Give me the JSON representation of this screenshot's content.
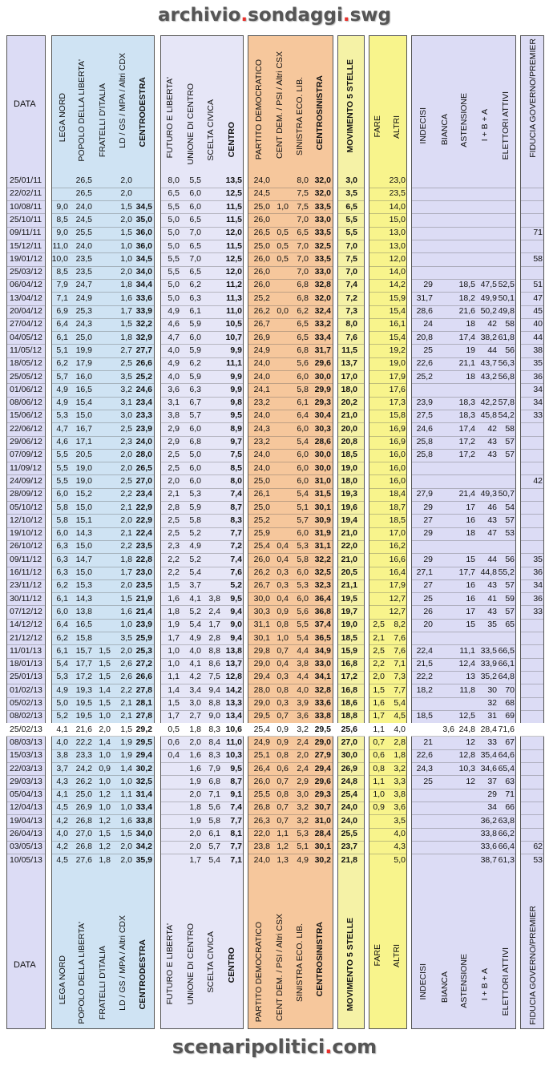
{
  "header_title": {
    "a": "archivio",
    "dot": ".",
    "b": "sondaggi",
    "dot2": ".",
    "c": "swg"
  },
  "footer_title": {
    "a": "scenaripolitici",
    "dot": ".",
    "b": "com"
  },
  "columns": {
    "data": "DATA",
    "lega": "LEGA NORD",
    "pdl": "POPOLO DELLA LIBERTA'",
    "fdi": "FRATELLI D'ITALIA",
    "ld": "LD / GS / MPA / Altri CDX",
    "cdx": "CENTRODESTRA",
    "fli": "FUTURO E LIBERTA'",
    "udc": "UNIONE DI CENTRO",
    "sc": "SCELTA CIVICA",
    "cen": "CENTRO",
    "pd": "PARTITO DEMOCRATICO",
    "cdem": "CENT DEM. / PSI / Altri CSX",
    "sel": "SINISTRA ECO. LIB.",
    "csx": "CENTROSINISTRA",
    "m5s": "MOVIMENTO 5 STELLE",
    "fare": "FARE",
    "altri": "ALTRI",
    "ind": "INDECISI",
    "bianca": "BIANCA",
    "ast": "ASTENSIONE",
    "ib": "I + B + A",
    "att": "ELETTORI ATTIVI",
    "fid": "FIDUCIA GOVERNO/PREMIER"
  },
  "colors": {
    "cdx": "#cfe3f3",
    "cen": "#e6e6f7",
    "csx": "#f6c79c",
    "m5s": "#f5f2a6",
    "other": "#dcdcf5"
  },
  "rows": [
    [
      "25/01/11",
      "",
      "26,5",
      "",
      "2,0",
      "",
      "8,0",
      "5,5",
      "",
      "13,5",
      "24,0",
      "",
      "8,0",
      "32,0",
      "3,0",
      "",
      "23,0",
      "",
      "",
      "",
      "",
      "",
      "",
      ""
    ],
    [
      "22/02/11",
      "",
      "26,5",
      "",
      "2,0",
      "",
      "6,5",
      "6,0",
      "",
      "12,5",
      "24,5",
      "",
      "7,5",
      "32,0",
      "3,5",
      "",
      "23,5",
      "",
      "",
      "",
      "",
      "",
      "",
      ""
    ],
    [
      "10/08/11",
      "9,0",
      "24,0",
      "",
      "1,5",
      "34,5",
      "5,5",
      "6,0",
      "",
      "11,5",
      "25,0",
      "1,0",
      "7,5",
      "33,5",
      "6,5",
      "",
      "14,0",
      "",
      "",
      "",
      "",
      "",
      "",
      ""
    ],
    [
      "25/10/11",
      "8,5",
      "24,5",
      "",
      "2,0",
      "35,0",
      "5,0",
      "6,5",
      "",
      "11,5",
      "26,0",
      "",
      "7,0",
      "33,0",
      "5,5",
      "",
      "15,0",
      "",
      "",
      "",
      "",
      "",
      "",
      ""
    ],
    [
      "09/11/11",
      "9,0",
      "25,5",
      "",
      "1,5",
      "36,0",
      "5,0",
      "7,0",
      "",
      "12,0",
      "26,5",
      "0,5",
      "6,5",
      "33,5",
      "5,5",
      "",
      "13,0",
      "",
      "",
      "",
      "",
      "",
      "",
      "71"
    ],
    [
      "15/12/11",
      "11,0",
      "24,0",
      "",
      "1,0",
      "36,0",
      "5,0",
      "6,5",
      "",
      "11,5",
      "25,0",
      "0,5",
      "7,0",
      "32,5",
      "7,0",
      "",
      "13,0",
      "",
      "",
      "",
      "",
      "",
      "",
      ""
    ],
    [
      "19/01/12",
      "10,0",
      "23,5",
      "",
      "1,0",
      "34,5",
      "5,5",
      "7,0",
      "",
      "12,5",
      "26,0",
      "0,5",
      "7,0",
      "33,5",
      "7,5",
      "",
      "12,0",
      "",
      "",
      "",
      "",
      "",
      "",
      "58"
    ],
    [
      "25/03/12",
      "8,5",
      "23,5",
      "",
      "2,0",
      "34,0",
      "5,5",
      "6,5",
      "",
      "12,0",
      "26,0",
      "",
      "7,0",
      "33,0",
      "7,0",
      "",
      "14,0",
      "",
      "",
      "",
      "",
      "",
      "",
      ""
    ],
    [
      "06/04/12",
      "7,9",
      "24,7",
      "",
      "1,8",
      "34,4",
      "5,0",
      "6,2",
      "",
      "11,2",
      "26,0",
      "",
      "6,8",
      "32,8",
      "7,4",
      "",
      "14,2",
      "29",
      "",
      "18,5",
      "47,5",
      "52,5",
      "",
      "51"
    ],
    [
      "13/04/12",
      "7,1",
      "24,9",
      "",
      "1,6",
      "33,6",
      "5,0",
      "6,3",
      "",
      "11,3",
      "25,2",
      "",
      "6,8",
      "32,0",
      "7,2",
      "",
      "15,9",
      "31,7",
      "",
      "18,2",
      "49,9",
      "50,1",
      "",
      "47"
    ],
    [
      "20/04/12",
      "6,9",
      "25,3",
      "",
      "1,7",
      "33,9",
      "4,9",
      "6,1",
      "",
      "11,0",
      "26,2",
      "0,0",
      "6,2",
      "32,4",
      "7,3",
      "",
      "15,4",
      "28,6",
      "",
      "21,6",
      "50,2",
      "49,8",
      "",
      "45"
    ],
    [
      "27/04/12",
      "6,4",
      "24,3",
      "",
      "1,5",
      "32,2",
      "4,6",
      "5,9",
      "",
      "10,5",
      "26,7",
      "",
      "6,5",
      "33,2",
      "8,0",
      "",
      "16,1",
      "24",
      "",
      "18",
      "42",
      "58",
      "",
      "40"
    ],
    [
      "04/05/12",
      "6,1",
      "25,0",
      "",
      "1,8",
      "32,9",
      "4,7",
      "6,0",
      "",
      "10,7",
      "26,9",
      "",
      "6,5",
      "33,4",
      "7,6",
      "",
      "15,4",
      "20,8",
      "",
      "17,4",
      "38,2",
      "61,8",
      "",
      "44"
    ],
    [
      "11/05/12",
      "5,1",
      "19,9",
      "",
      "2,7",
      "27,7",
      "4,0",
      "5,9",
      "",
      "9,9",
      "24,9",
      "",
      "6,8",
      "31,7",
      "11,5",
      "",
      "19,2",
      "25",
      "",
      "19",
      "44",
      "56",
      "",
      "38"
    ],
    [
      "18/05/12",
      "6,2",
      "17,9",
      "",
      "2,5",
      "26,6",
      "4,9",
      "6,2",
      "",
      "11,1",
      "24,0",
      "",
      "5,6",
      "29,6",
      "13,7",
      "",
      "19,0",
      "22,6",
      "",
      "21,1",
      "43,7",
      "56,3",
      "",
      "35"
    ],
    [
      "25/05/12",
      "5,7",
      "16,0",
      "",
      "3,5",
      "25,2",
      "4,0",
      "5,9",
      "",
      "9,9",
      "24,0",
      "",
      "6,0",
      "30,0",
      "17,0",
      "",
      "17,9",
      "25,2",
      "",
      "18",
      "43,2",
      "56,8",
      "",
      "36"
    ],
    [
      "01/06/12",
      "4,9",
      "16,5",
      "",
      "3,2",
      "24,6",
      "3,6",
      "6,3",
      "",
      "9,9",
      "24,1",
      "",
      "5,8",
      "29,9",
      "18,0",
      "",
      "17,6",
      "",
      "",
      "",
      "",
      "",
      "",
      "34"
    ],
    [
      "08/06/12",
      "4,9",
      "15,4",
      "",
      "3,1",
      "23,4",
      "3,1",
      "6,7",
      "",
      "9,8",
      "23,2",
      "",
      "6,1",
      "29,3",
      "20,2",
      "",
      "17,3",
      "23,9",
      "",
      "18,3",
      "42,2",
      "57,8",
      "",
      "34"
    ],
    [
      "15/06/12",
      "5,3",
      "15,0",
      "",
      "3,0",
      "23,3",
      "3,8",
      "5,7",
      "",
      "9,5",
      "24,0",
      "",
      "6,4",
      "30,4",
      "21,0",
      "",
      "15,8",
      "27,5",
      "",
      "18,3",
      "45,8",
      "54,2",
      "",
      "33"
    ],
    [
      "22/06/12",
      "4,7",
      "16,7",
      "",
      "2,5",
      "23,9",
      "2,9",
      "6,0",
      "",
      "8,9",
      "24,3",
      "",
      "6,0",
      "30,3",
      "20,0",
      "",
      "16,9",
      "24,6",
      "",
      "17,4",
      "42",
      "58",
      "",
      ""
    ],
    [
      "29/06/12",
      "4,6",
      "17,1",
      "",
      "2,3",
      "24,0",
      "2,9",
      "6,8",
      "",
      "9,7",
      "23,2",
      "",
      "5,4",
      "28,6",
      "20,8",
      "",
      "16,9",
      "25,8",
      "",
      "17,2",
      "43",
      "57",
      "",
      ""
    ],
    [
      "07/09/12",
      "5,5",
      "20,5",
      "",
      "2,0",
      "28,0",
      "2,5",
      "5,0",
      "",
      "7,5",
      "24,0",
      "",
      "6,0",
      "30,0",
      "18,5",
      "",
      "16,0",
      "25,8",
      "",
      "17,2",
      "43",
      "57",
      "",
      ""
    ],
    [
      "11/09/12",
      "5,5",
      "19,0",
      "",
      "2,0",
      "26,5",
      "2,5",
      "6,0",
      "",
      "8,5",
      "24,0",
      "",
      "6,0",
      "30,0",
      "19,0",
      "",
      "16,0",
      "",
      "",
      "",
      "",
      "",
      "",
      ""
    ],
    [
      "24/09/12",
      "5,5",
      "19,0",
      "",
      "2,5",
      "27,0",
      "2,0",
      "6,0",
      "",
      "8,0",
      "25,0",
      "",
      "6,0",
      "31,0",
      "18,0",
      "",
      "16,0",
      "",
      "",
      "",
      "",
      "",
      "",
      "42"
    ],
    [
      "28/09/12",
      "6,0",
      "15,2",
      "",
      "2,2",
      "23,4",
      "2,1",
      "5,3",
      "",
      "7,4",
      "26,1",
      "",
      "5,4",
      "31,5",
      "19,3",
      "",
      "18,4",
      "27,9",
      "",
      "21,4",
      "49,3",
      "50,7",
      "",
      ""
    ],
    [
      "05/10/12",
      "5,8",
      "15,0",
      "",
      "2,1",
      "22,9",
      "2,8",
      "5,9",
      "",
      "8,7",
      "25,0",
      "",
      "5,1",
      "30,1",
      "19,6",
      "",
      "18,7",
      "29",
      "",
      "17",
      "46",
      "54",
      "",
      ""
    ],
    [
      "12/10/12",
      "5,8",
      "15,1",
      "",
      "2,0",
      "22,9",
      "2,5",
      "5,8",
      "",
      "8,3",
      "25,2",
      "",
      "5,7",
      "30,9",
      "19,4",
      "",
      "18,5",
      "27",
      "",
      "16",
      "43",
      "57",
      "",
      ""
    ],
    [
      "19/10/12",
      "6,0",
      "14,3",
      "",
      "2,1",
      "22,4",
      "2,5",
      "5,2",
      "",
      "7,7",
      "25,9",
      "",
      "6,0",
      "31,9",
      "21,0",
      "",
      "17,0",
      "29",
      "",
      "18",
      "47",
      "53",
      "",
      ""
    ],
    [
      "26/10/12",
      "6,3",
      "15,0",
      "",
      "2,2",
      "23,5",
      "2,3",
      "4,9",
      "",
      "7,2",
      "25,4",
      "0,4",
      "5,3",
      "31,1",
      "22,0",
      "",
      "16,2",
      "",
      "",
      "",
      "",
      "",
      "",
      ""
    ],
    [
      "09/11/12",
      "6,3",
      "14,7",
      "",
      "1,8",
      "22,8",
      "2,2",
      "5,2",
      "",
      "7,4",
      "26,0",
      "0,4",
      "5,8",
      "32,2",
      "21,0",
      "",
      "16,6",
      "29",
      "",
      "15",
      "44",
      "56",
      "",
      "35"
    ],
    [
      "16/11/12",
      "6,3",
      "15,0",
      "",
      "1,7",
      "23,0",
      "2,2",
      "5,4",
      "",
      "7,6",
      "26,2",
      "0,3",
      "6,0",
      "32,5",
      "20,5",
      "",
      "16,4",
      "27,1",
      "",
      "17,7",
      "44,8",
      "55,2",
      "",
      "36"
    ],
    [
      "23/11/12",
      "6,2",
      "15,3",
      "",
      "2,0",
      "23,5",
      "1,5",
      "3,7",
      "",
      "5,2",
      "26,7",
      "0,3",
      "5,3",
      "32,3",
      "21,1",
      "",
      "17,9",
      "27",
      "",
      "16",
      "43",
      "57",
      "",
      "34"
    ],
    [
      "30/11/12",
      "6,1",
      "14,3",
      "",
      "1,5",
      "21,9",
      "1,6",
      "4,1",
      "3,8",
      "9,5",
      "30,0",
      "0,4",
      "6,0",
      "36,4",
      "19,5",
      "",
      "12,7",
      "25",
      "",
      "16",
      "41",
      "59",
      "",
      "36"
    ],
    [
      "07/12/12",
      "6,0",
      "13,8",
      "",
      "1,6",
      "21,4",
      "1,8",
      "5,2",
      "2,4",
      "9,4",
      "30,3",
      "0,9",
      "5,6",
      "36,8",
      "19,7",
      "",
      "12,7",
      "26",
      "",
      "17",
      "43",
      "57",
      "",
      "33"
    ],
    [
      "14/12/12",
      "6,4",
      "16,5",
      "",
      "1,0",
      "23,9",
      "1,9",
      "5,4",
      "1,7",
      "9,0",
      "31,1",
      "0,8",
      "5,5",
      "37,4",
      "19,0",
      "2,5",
      "8,2",
      "20",
      "",
      "15",
      "35",
      "65",
      "",
      ""
    ],
    [
      "21/12/12",
      "6,2",
      "15,8",
      "",
      "3,5",
      "25,9",
      "1,7",
      "4,9",
      "2,8",
      "9,4",
      "30,1",
      "1,0",
      "5,4",
      "36,5",
      "18,5",
      "2,1",
      "7,6",
      "",
      "",
      "",
      "",
      "",
      "",
      ""
    ],
    [
      "11/01/13",
      "6,1",
      "15,7",
      "1,5",
      "2,0",
      "25,3",
      "1,0",
      "4,0",
      "8,8",
      "13,8",
      "29,8",
      "0,7",
      "4,4",
      "34,9",
      "15,9",
      "2,5",
      "7,6",
      "22,4",
      "",
      "11,1",
      "33,5",
      "66,5",
      "",
      ""
    ],
    [
      "18/01/13",
      "5,4",
      "17,7",
      "1,5",
      "2,6",
      "27,2",
      "1,0",
      "4,1",
      "8,6",
      "13,7",
      "29,0",
      "0,4",
      "3,8",
      "33,0",
      "16,8",
      "2,2",
      "7,1",
      "21,5",
      "",
      "12,4",
      "33,9",
      "66,1",
      "",
      ""
    ],
    [
      "25/01/13",
      "5,3",
      "17,2",
      "1,5",
      "2,6",
      "26,6",
      "1,1",
      "4,2",
      "7,5",
      "12,8",
      "29,4",
      "0,3",
      "4,4",
      "34,1",
      "17,2",
      "2,0",
      "7,3",
      "22,2",
      "",
      "13",
      "35,2",
      "64,8",
      "",
      ""
    ],
    [
      "01/02/13",
      "4,9",
      "19,3",
      "1,4",
      "2,2",
      "27,8",
      "1,4",
      "3,4",
      "9,4",
      "14,2",
      "28,0",
      "0,8",
      "4,0",
      "32,8",
      "16,8",
      "1,5",
      "7,7",
      "18,2",
      "",
      "11,8",
      "30",
      "70",
      "",
      ""
    ],
    [
      "05/02/13",
      "5,0",
      "19,5",
      "1,5",
      "2,1",
      "28,1",
      "1,5",
      "3,0",
      "8,8",
      "13,3",
      "29,0",
      "0,3",
      "3,9",
      "33,6",
      "18,6",
      "1,6",
      "5,4",
      "",
      "",
      "",
      "32",
      "68",
      "",
      ""
    ],
    [
      "08/02/13",
      "5,2",
      "19,5",
      "1,0",
      "2,1",
      "27,8",
      "1,7",
      "2,7",
      "9,0",
      "13,4",
      "29,5",
      "0,7",
      "3,6",
      "33,8",
      "18,8",
      "1,7",
      "4,5",
      "18,5",
      "",
      "12,5",
      "31",
      "69",
      "",
      ""
    ],
    [
      "25/02/13",
      "4,1",
      "21,6",
      "2,0",
      "1,5",
      "29,2",
      "0,5",
      "1,8",
      "8,3",
      "10,6",
      "25,4",
      "0,9",
      "3,2",
      "29,5",
      "25,6",
      "1,1",
      "4,0",
      "",
      "3,6",
      "24,8",
      "28,4",
      "71,6",
      "",
      ""
    ],
    [
      "08/03/13",
      "4,0",
      "22,2",
      "1,4",
      "1,9",
      "29,5",
      "0,6",
      "2,0",
      "8,4",
      "11,0",
      "24,9",
      "0,9",
      "2,4",
      "29,0",
      "27,0",
      "0,7",
      "2,8",
      "21",
      "",
      "12",
      "33",
      "67",
      "",
      ""
    ],
    [
      "15/03/13",
      "3,8",
      "23,3",
      "1,0",
      "1,9",
      "29,4",
      "0,4",
      "1,6",
      "8,3",
      "10,3",
      "25,1",
      "0,8",
      "2,0",
      "27,9",
      "30,0",
      "0,6",
      "1,8",
      "22,6",
      "",
      "12,8",
      "35,4",
      "64,6",
      "",
      ""
    ],
    [
      "22/03/13",
      "3,7",
      "24,2",
      "0,9",
      "1,4",
      "30,2",
      "",
      "1,6",
      "7,9",
      "9,5",
      "26,4",
      "0,6",
      "2,4",
      "29,4",
      "26,9",
      "0,8",
      "3,2",
      "24,3",
      "",
      "10,3",
      "34,6",
      "65,4",
      "",
      ""
    ],
    [
      "29/03/13",
      "4,3",
      "26,2",
      "1,0",
      "1,0",
      "32,5",
      "",
      "1,9",
      "6,8",
      "8,7",
      "26,0",
      "0,7",
      "2,9",
      "29,6",
      "24,8",
      "1,1",
      "3,3",
      "25",
      "",
      "12",
      "37",
      "63",
      "",
      ""
    ],
    [
      "05/04/13",
      "4,1",
      "25,0",
      "1,2",
      "1,1",
      "31,4",
      "",
      "2,0",
      "7,1",
      "9,1",
      "25,5",
      "0,8",
      "3,0",
      "29,3",
      "25,4",
      "1,0",
      "3,8",
      "",
      "",
      "",
      "29",
      "71",
      "",
      ""
    ],
    [
      "12/04/13",
      "4,5",
      "26,9",
      "1,0",
      "1,0",
      "33,4",
      "",
      "1,8",
      "5,6",
      "7,4",
      "26,8",
      "0,7",
      "3,2",
      "30,7",
      "24,0",
      "0,9",
      "3,6",
      "",
      "",
      "",
      "34",
      "66",
      "",
      ""
    ],
    [
      "19/04/13",
      "4,2",
      "26,8",
      "1,2",
      "1,6",
      "33,8",
      "",
      "1,9",
      "5,8",
      "7,7",
      "26,3",
      "0,7",
      "3,2",
      "31,0",
      "24,0",
      "",
      "3,5",
      "",
      "",
      "",
      "36,2",
      "63,8",
      "",
      ""
    ],
    [
      "26/04/13",
      "4,0",
      "27,0",
      "1,5",
      "1,5",
      "34,0",
      "",
      "2,0",
      "6,1",
      "8,1",
      "22,0",
      "1,1",
      "5,3",
      "28,4",
      "25,5",
      "",
      "4,0",
      "",
      "",
      "",
      "33,8",
      "66,2",
      "",
      ""
    ],
    [
      "03/05/13",
      "4,2",
      "26,8",
      "1,2",
      "2,0",
      "34,2",
      "",
      "2,0",
      "5,7",
      "7,7",
      "23,8",
      "1,2",
      "5,1",
      "30,1",
      "23,7",
      "",
      "4,3",
      "",
      "",
      "",
      "33,6",
      "66,4",
      "",
      "62"
    ],
    [
      "10/05/13",
      "4,5",
      "27,6",
      "1,8",
      "2,0",
      "35,9",
      "",
      "1,7",
      "5,4",
      "7,1",
      "24,0",
      "1,3",
      "4,9",
      "30,2",
      "21,8",
      "",
      "5,0",
      "",
      "",
      "",
      "38,7",
      "61,3",
      "",
      "53"
    ]
  ]
}
